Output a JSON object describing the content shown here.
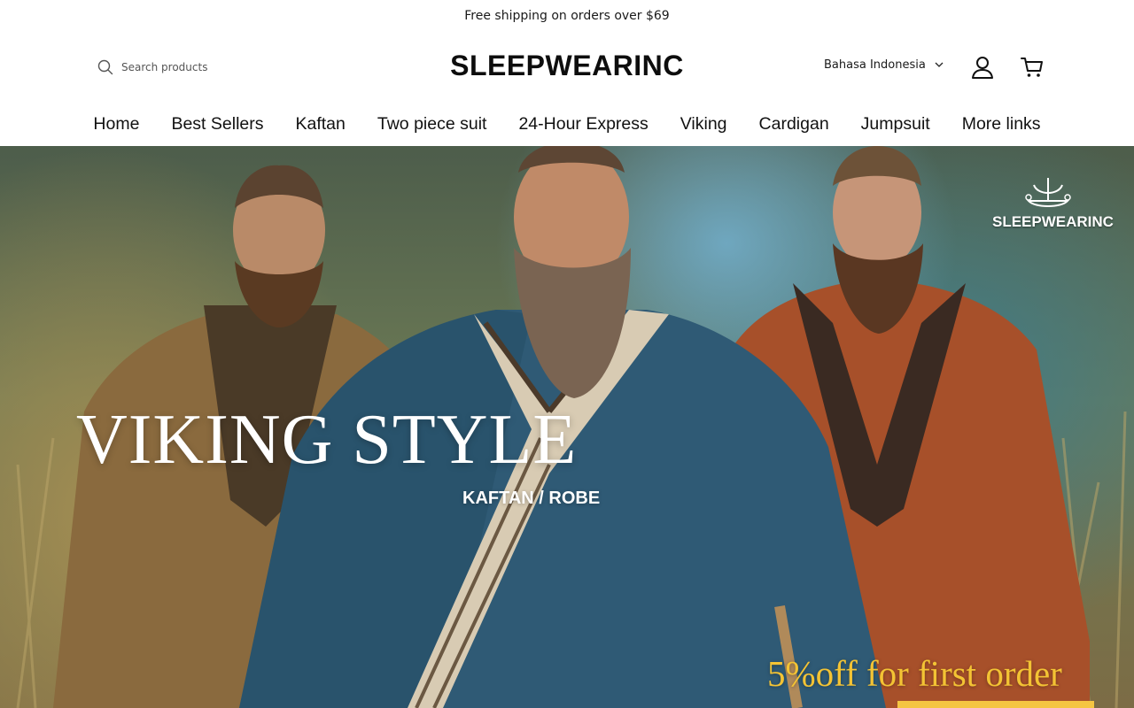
{
  "announcement": {
    "text": "Free shipping on orders over $69"
  },
  "header": {
    "search_placeholder": "Search products",
    "logo": "SLEEPWEARINC",
    "language": "Bahasa Indonesia"
  },
  "nav": {
    "items": [
      {
        "label": "Home"
      },
      {
        "label": "Best Sellers"
      },
      {
        "label": "Kaftan"
      },
      {
        "label": "Two piece suit"
      },
      {
        "label": "24-Hour Express"
      },
      {
        "label": "Viking"
      },
      {
        "label": "Cardigan"
      },
      {
        "label": "Jumpsuit"
      },
      {
        "label": "More links"
      }
    ]
  },
  "hero": {
    "brand_mark": "SLEEPWEARINC",
    "title": "VIKING STYLE",
    "subtitle": "KAFTAN / ROBE",
    "promo": "5%off for first order",
    "colors": {
      "promo": "#f3c334",
      "promo_bar": "#f5c542"
    }
  }
}
